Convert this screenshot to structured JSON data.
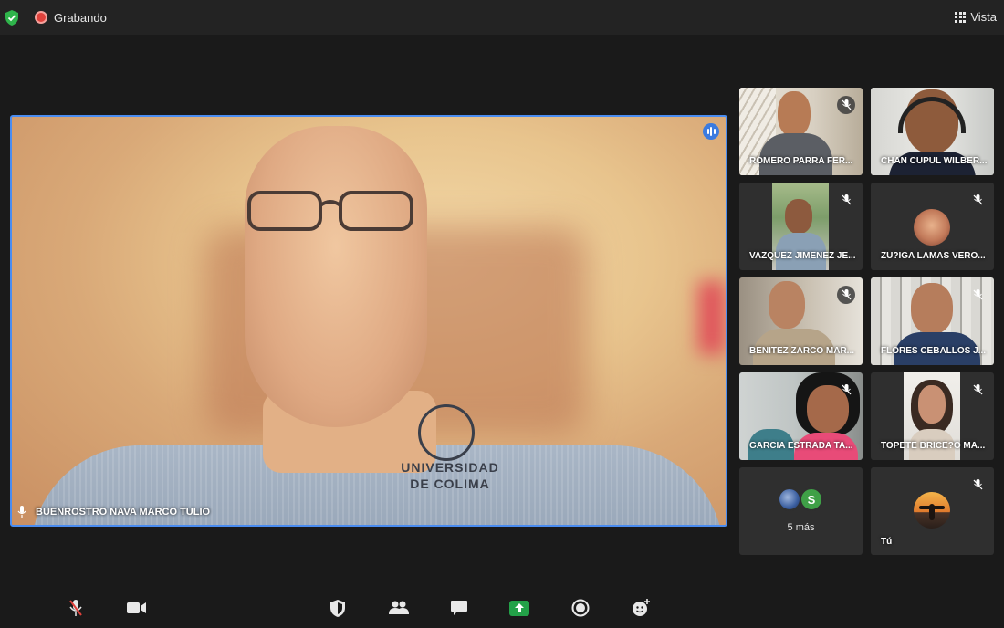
{
  "topbar": {
    "recording_label": "Grabando",
    "view_label": "Vista",
    "security_icon": "shield-check-icon",
    "recording_icon": "recording-dot-icon",
    "view_icon": "grid-icon"
  },
  "main_speaker": {
    "name": "BUENROSTRO NAVA MARCO TULIO",
    "shirt_text": "UNIVERSIDAD DE COLIMA",
    "active_speaker_color": "#4a8cf0"
  },
  "participants": [
    {
      "name": "ROMERO PARRA FER...",
      "muted": true
    },
    {
      "name": "CHAN CUPUL WILBER...",
      "muted": false
    },
    {
      "name": "VAZQUEZ JIMENEZ JE...",
      "muted": true
    },
    {
      "name": "ZU?IGA LAMAS VERO...",
      "muted": true
    },
    {
      "name": "BENITEZ ZARCO MAR...",
      "muted": true
    },
    {
      "name": "FLORES CEBALLOS J...",
      "muted": true
    },
    {
      "name": "GARCIA ESTRADA TA...",
      "muted": true
    },
    {
      "name": "TOPETE BRICE?O MA...",
      "muted": true
    }
  ],
  "more_tile": {
    "label": "5 más",
    "avatar_letter": "S",
    "avatar_color": "#3fa047"
  },
  "self_tile": {
    "label": "Tú",
    "muted": true
  },
  "toolbar": {
    "items": [
      "microphone-muted-icon",
      "camera-icon",
      "security-icon",
      "participants-icon",
      "chat-icon",
      "share-screen-icon",
      "record-icon",
      "reactions-icon"
    ],
    "share_color": "#23a148"
  }
}
